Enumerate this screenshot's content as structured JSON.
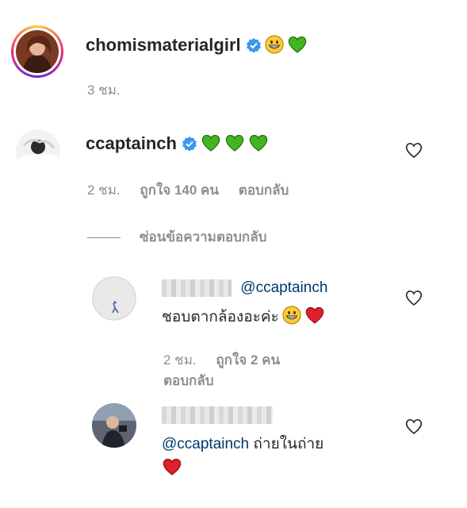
{
  "comments": [
    {
      "username": "chomismaterialgirl",
      "verified": true,
      "emojis": [
        "grinning-face",
        "green-heart"
      ],
      "time": "3 ชม."
    },
    {
      "username": "ccaptainch",
      "verified": true,
      "emojis": [
        "green-heart",
        "green-heart",
        "green-heart"
      ],
      "time": "2 ชม.",
      "likes": "ถูกใจ 140 คน",
      "reply_label": "ตอบกลับ",
      "hide_replies_label": "ซ่อนข้อความตอบกลับ"
    }
  ],
  "replies": [
    {
      "mention": "@ccaptainch",
      "text": "ชอบตากล้องอะค่ะ",
      "emojis": [
        "grinning-face",
        "red-heart"
      ],
      "time": "2 ชม.",
      "likes": "ถูกใจ 2 คน",
      "reply_label": "ตอบกลับ"
    },
    {
      "mention": "@ccaptainch",
      "text": "ถ่ายในถ่าย",
      "emojis": [
        "red-heart"
      ]
    }
  ],
  "colors": {
    "verified": "#3897f0",
    "green_heart": "#43b51f",
    "red_heart": "#e0202a",
    "mention": "#00376b",
    "meta": "#8e8e8e"
  }
}
